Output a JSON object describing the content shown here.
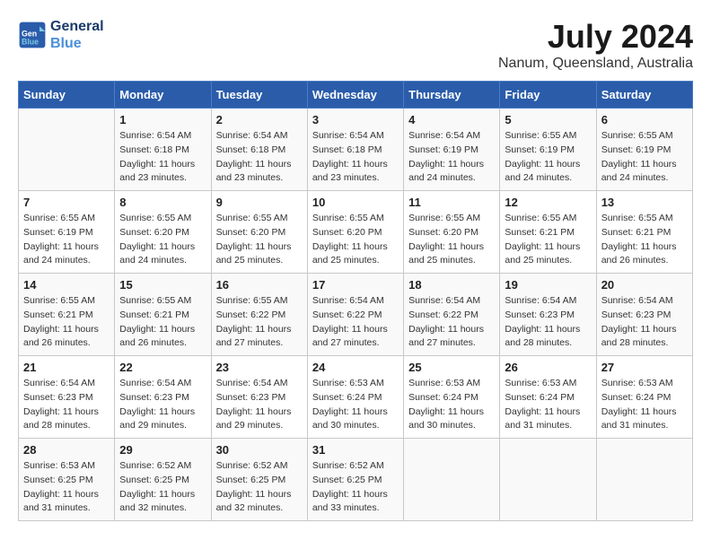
{
  "header": {
    "logo_line1": "General",
    "logo_line2": "Blue",
    "month_year": "July 2024",
    "location": "Nanum, Queensland, Australia"
  },
  "weekdays": [
    "Sunday",
    "Monday",
    "Tuesday",
    "Wednesday",
    "Thursday",
    "Friday",
    "Saturday"
  ],
  "weeks": [
    [
      {
        "day": "",
        "info": ""
      },
      {
        "day": "1",
        "info": "Sunrise: 6:54 AM\nSunset: 6:18 PM\nDaylight: 11 hours\nand 23 minutes."
      },
      {
        "day": "2",
        "info": "Sunrise: 6:54 AM\nSunset: 6:18 PM\nDaylight: 11 hours\nand 23 minutes."
      },
      {
        "day": "3",
        "info": "Sunrise: 6:54 AM\nSunset: 6:18 PM\nDaylight: 11 hours\nand 23 minutes."
      },
      {
        "day": "4",
        "info": "Sunrise: 6:54 AM\nSunset: 6:19 PM\nDaylight: 11 hours\nand 24 minutes."
      },
      {
        "day": "5",
        "info": "Sunrise: 6:55 AM\nSunset: 6:19 PM\nDaylight: 11 hours\nand 24 minutes."
      },
      {
        "day": "6",
        "info": "Sunrise: 6:55 AM\nSunset: 6:19 PM\nDaylight: 11 hours\nand 24 minutes."
      }
    ],
    [
      {
        "day": "7",
        "info": "Sunrise: 6:55 AM\nSunset: 6:19 PM\nDaylight: 11 hours\nand 24 minutes."
      },
      {
        "day": "8",
        "info": "Sunrise: 6:55 AM\nSunset: 6:20 PM\nDaylight: 11 hours\nand 24 minutes."
      },
      {
        "day": "9",
        "info": "Sunrise: 6:55 AM\nSunset: 6:20 PM\nDaylight: 11 hours\nand 25 minutes."
      },
      {
        "day": "10",
        "info": "Sunrise: 6:55 AM\nSunset: 6:20 PM\nDaylight: 11 hours\nand 25 minutes."
      },
      {
        "day": "11",
        "info": "Sunrise: 6:55 AM\nSunset: 6:20 PM\nDaylight: 11 hours\nand 25 minutes."
      },
      {
        "day": "12",
        "info": "Sunrise: 6:55 AM\nSunset: 6:21 PM\nDaylight: 11 hours\nand 25 minutes."
      },
      {
        "day": "13",
        "info": "Sunrise: 6:55 AM\nSunset: 6:21 PM\nDaylight: 11 hours\nand 26 minutes."
      }
    ],
    [
      {
        "day": "14",
        "info": "Sunrise: 6:55 AM\nSunset: 6:21 PM\nDaylight: 11 hours\nand 26 minutes."
      },
      {
        "day": "15",
        "info": "Sunrise: 6:55 AM\nSunset: 6:21 PM\nDaylight: 11 hours\nand 26 minutes."
      },
      {
        "day": "16",
        "info": "Sunrise: 6:55 AM\nSunset: 6:22 PM\nDaylight: 11 hours\nand 27 minutes."
      },
      {
        "day": "17",
        "info": "Sunrise: 6:54 AM\nSunset: 6:22 PM\nDaylight: 11 hours\nand 27 minutes."
      },
      {
        "day": "18",
        "info": "Sunrise: 6:54 AM\nSunset: 6:22 PM\nDaylight: 11 hours\nand 27 minutes."
      },
      {
        "day": "19",
        "info": "Sunrise: 6:54 AM\nSunset: 6:23 PM\nDaylight: 11 hours\nand 28 minutes."
      },
      {
        "day": "20",
        "info": "Sunrise: 6:54 AM\nSunset: 6:23 PM\nDaylight: 11 hours\nand 28 minutes."
      }
    ],
    [
      {
        "day": "21",
        "info": "Sunrise: 6:54 AM\nSunset: 6:23 PM\nDaylight: 11 hours\nand 28 minutes."
      },
      {
        "day": "22",
        "info": "Sunrise: 6:54 AM\nSunset: 6:23 PM\nDaylight: 11 hours\nand 29 minutes."
      },
      {
        "day": "23",
        "info": "Sunrise: 6:54 AM\nSunset: 6:23 PM\nDaylight: 11 hours\nand 29 minutes."
      },
      {
        "day": "24",
        "info": "Sunrise: 6:53 AM\nSunset: 6:24 PM\nDaylight: 11 hours\nand 30 minutes."
      },
      {
        "day": "25",
        "info": "Sunrise: 6:53 AM\nSunset: 6:24 PM\nDaylight: 11 hours\nand 30 minutes."
      },
      {
        "day": "26",
        "info": "Sunrise: 6:53 AM\nSunset: 6:24 PM\nDaylight: 11 hours\nand 31 minutes."
      },
      {
        "day": "27",
        "info": "Sunrise: 6:53 AM\nSunset: 6:24 PM\nDaylight: 11 hours\nand 31 minutes."
      }
    ],
    [
      {
        "day": "28",
        "info": "Sunrise: 6:53 AM\nSunset: 6:25 PM\nDaylight: 11 hours\nand 31 minutes."
      },
      {
        "day": "29",
        "info": "Sunrise: 6:52 AM\nSunset: 6:25 PM\nDaylight: 11 hours\nand 32 minutes."
      },
      {
        "day": "30",
        "info": "Sunrise: 6:52 AM\nSunset: 6:25 PM\nDaylight: 11 hours\nand 32 minutes."
      },
      {
        "day": "31",
        "info": "Sunrise: 6:52 AM\nSunset: 6:25 PM\nDaylight: 11 hours\nand 33 minutes."
      },
      {
        "day": "",
        "info": ""
      },
      {
        "day": "",
        "info": ""
      },
      {
        "day": "",
        "info": ""
      }
    ]
  ]
}
